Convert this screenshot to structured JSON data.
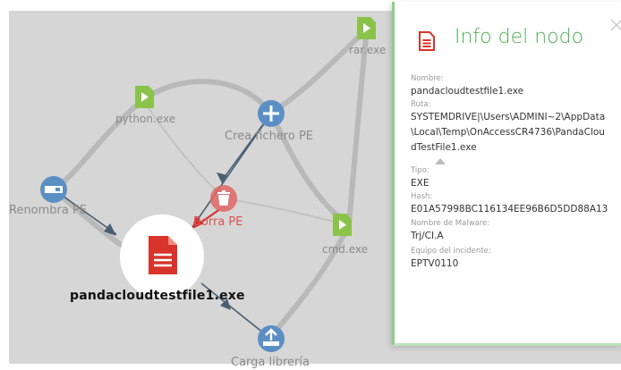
{
  "graph": {
    "nodes": {
      "rar": {
        "label": "rar.exe"
      },
      "python": {
        "label": "python.exe"
      },
      "crea": {
        "label": "Crea fichero PE"
      },
      "renombra": {
        "label": "Renombra PE"
      },
      "borra": {
        "label": "Borra PE"
      },
      "cmd": {
        "label": "cmd.exe"
      },
      "carga": {
        "label": "Carga librería"
      },
      "focus": {
        "label": "pandacloudtestfile1.exe"
      }
    },
    "colors": {
      "background": "#d6d6d6",
      "edge": "#b9b9b9",
      "edge_dark": "#4a5f72",
      "action_node": "#5b8fc4",
      "file_node": "#8bc34a",
      "delete_node": "#e06666",
      "focus_node": "#d9342b"
    }
  },
  "panel": {
    "title": "Info del nodo",
    "icon": "file-icon",
    "close_icon": "close-icon",
    "fields": {
      "nombre_label": "Nombre:",
      "nombre_value": "pandacloudtestfile1.exe",
      "ruta_label": "Ruta:",
      "ruta_line1": "SYSTEMDRIVE|\\Users\\ADMINI~2\\AppData",
      "ruta_line2": "\\Local\\Temp\\OnAccessCR4736\\PandaClou",
      "ruta_line3": "dTestFile1.exe",
      "tipo_label": "Tipo:",
      "tipo_value": "EXE",
      "hash_label": "Hash:",
      "hash_value": "E01A57998BC116134EE96B6D5DD88A13",
      "malware_label": "Nombre de Malware:",
      "malware_value": "Trj/CI.A",
      "equipo_label": "Equipo del incidente:",
      "equipo_value": "EPTV0110"
    }
  }
}
